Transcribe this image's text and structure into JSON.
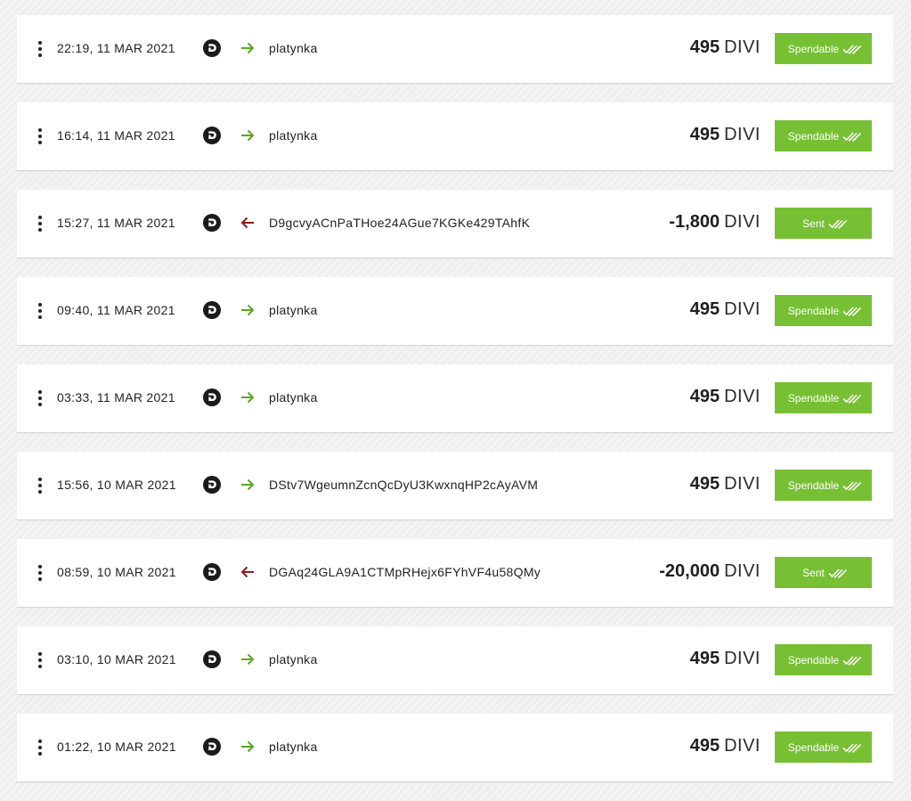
{
  "currency_unit": "DIVI",
  "colors": {
    "badge_bg": "#77c034",
    "incoming_arrow": "#5aa820",
    "outgoing_arrow": "#8e1b1b"
  },
  "icons": {
    "row_menu": "kebab-menu-icon",
    "coin": "divi-logo-icon",
    "incoming": "arrow-right-icon",
    "outgoing": "arrow-left-icon",
    "status_check": "double-check-icon"
  },
  "transactions": [
    {
      "time": "22:19, 11 MAR 2021",
      "direction": "in",
      "address": "platynka",
      "amount": "495",
      "status": "Spendable"
    },
    {
      "time": "16:14, 11 MAR 2021",
      "direction": "in",
      "address": "platynka",
      "amount": "495",
      "status": "Spendable"
    },
    {
      "time": "15:27, 11 MAR 2021",
      "direction": "out",
      "address": "D9gcvyACnPaTHoe24AGue7KGKe429TAhfK",
      "amount": "-1,800",
      "status": "Sent"
    },
    {
      "time": "09:40, 11 MAR 2021",
      "direction": "in",
      "address": "platynka",
      "amount": "495",
      "status": "Spendable"
    },
    {
      "time": "03:33, 11 MAR 2021",
      "direction": "in",
      "address": "platynka",
      "amount": "495",
      "status": "Spendable"
    },
    {
      "time": "15:56, 10 MAR 2021",
      "direction": "in",
      "address": "DStv7WgeumnZcnQcDyU3KwxnqHP2cAyAVM",
      "amount": "495",
      "status": "Spendable"
    },
    {
      "time": "08:59, 10 MAR 2021",
      "direction": "out",
      "address": "DGAq24GLA9A1CTMpRHejx6FYhVF4u58QMy",
      "amount": "-20,000",
      "status": "Sent"
    },
    {
      "time": "03:10, 10 MAR 2021",
      "direction": "in",
      "address": "platynka",
      "amount": "495",
      "status": "Spendable"
    },
    {
      "time": "01:22, 10 MAR 2021",
      "direction": "in",
      "address": "platynka",
      "amount": "495",
      "status": "Spendable"
    }
  ]
}
